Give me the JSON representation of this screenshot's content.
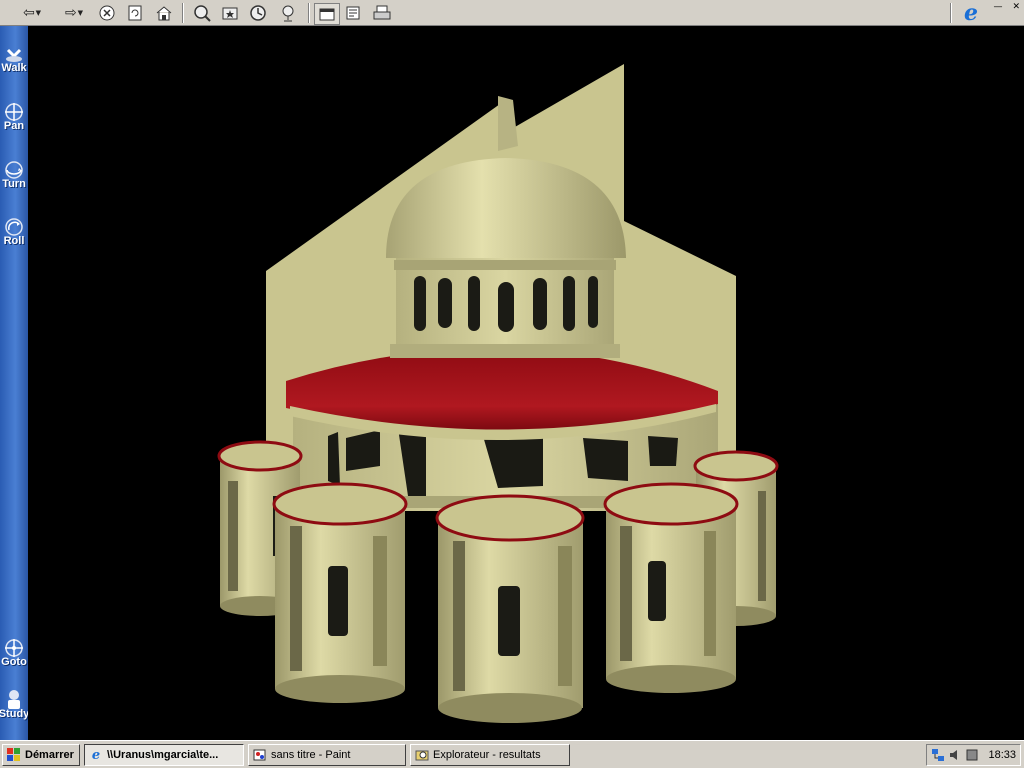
{
  "toolbar": {
    "icons": [
      "back-icon",
      "forward-icon",
      "stop-icon",
      "refresh-icon",
      "home-icon",
      "search-icon",
      "favorites-icon",
      "history-icon",
      "channels-icon",
      "fullscreen-icon",
      "mail-icon",
      "print-icon"
    ],
    "browser_logo": "e"
  },
  "nav": {
    "items": [
      {
        "label": "Walk",
        "icon": "walk-icon"
      },
      {
        "label": "Pan",
        "icon": "pan-icon"
      },
      {
        "label": "Turn",
        "icon": "turn-icon"
      },
      {
        "label": "Roll",
        "icon": "roll-icon"
      },
      {
        "label": "Goto",
        "icon": "goto-icon"
      },
      {
        "label": "Study",
        "icon": "study-icon"
      }
    ]
  },
  "scene": {
    "colors": {
      "stone": "#c9c58f",
      "stone_dark": "#9c986a",
      "stone_light": "#e4e0ad",
      "roof": "#8e0b12",
      "roof_light": "#b01820"
    }
  },
  "taskbar": {
    "start_label": "Démarrer",
    "tasks": [
      {
        "label": "\\\\Uranus\\mgarcia\\te...",
        "icon": "ie-icon",
        "active": true
      },
      {
        "label": "sans titre - Paint",
        "icon": "paint-icon",
        "active": false
      },
      {
        "label": "Explorateur - resultats",
        "icon": "explorer-icon",
        "active": false
      }
    ],
    "tray_icons": [
      "network-icon",
      "volume-icon",
      "tray-app-icon"
    ],
    "clock": "18:33"
  }
}
